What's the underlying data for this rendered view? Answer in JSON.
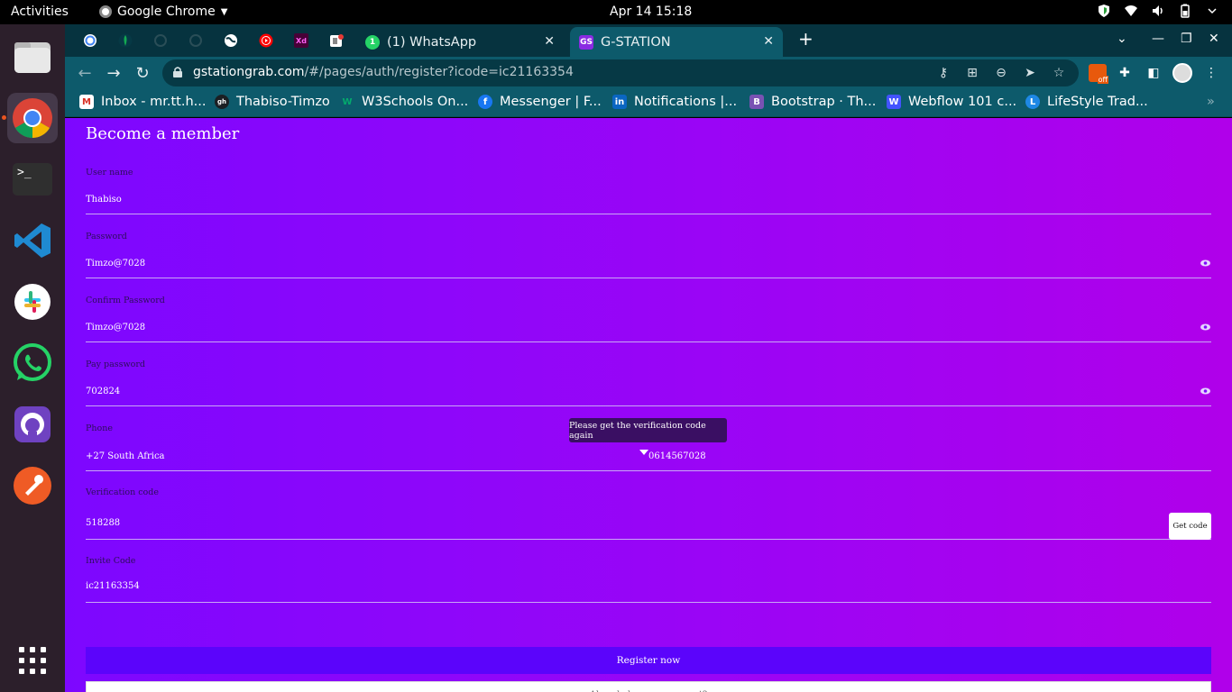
{
  "topbar": {
    "activities": "Activities",
    "app_name": "Google Chrome",
    "clock": "Apr 14  15:18"
  },
  "dock": {
    "items": [
      "files-icon",
      "chrome-icon",
      "terminal-icon",
      "vscode-icon",
      "slack-icon",
      "whatsapp-icon",
      "github-desktop-icon",
      "postman-icon",
      "app-grid-icon"
    ],
    "terminal_glyph": ">_"
  },
  "tabs": [
    {
      "label": "(1) WhatsApp",
      "badge": "1"
    },
    {
      "label": "G-STATION",
      "badge": "GS"
    }
  ],
  "pinned_tab_glyphs": {
    "xd": "Xd"
  },
  "address_bar": {
    "host": "gstationgrab.com",
    "path": "/#/pages/auth/register?icode=ic21163354"
  },
  "bookmarks": [
    {
      "label": "Inbox - mr.tt.h...",
      "icon": "M"
    },
    {
      "label": "Thabiso-Timzo",
      "icon": "gh"
    },
    {
      "label": "W3Schools On...",
      "icon": "W"
    },
    {
      "label": "Messenger | F...",
      "icon": "f"
    },
    {
      "label": "Notifications |...",
      "icon": "in"
    },
    {
      "label": "Bootstrap · Th...",
      "icon": "B"
    },
    {
      "label": "Webflow 101 c...",
      "icon": "W"
    },
    {
      "label": "LifeStyle Trad...",
      "icon": "L"
    }
  ],
  "extension_badge": "off",
  "form": {
    "title": "Become a member",
    "fields": {
      "username": {
        "label": "User name",
        "value": "Thabiso"
      },
      "password": {
        "label": "Password",
        "value": "Timzo@7028"
      },
      "confirm_password": {
        "label": "Confirm Password",
        "value": "Timzo@7028"
      },
      "pay_password": {
        "label": "Pay password",
        "value": "702824"
      },
      "phone": {
        "label": "Phone",
        "country": "+27 South Africa",
        "number": "0614567028"
      },
      "verification": {
        "label": "Verification code",
        "value": "518288",
        "button": "Get code"
      },
      "invite": {
        "label": "Invite Code",
        "value": "ic21163354"
      }
    },
    "toast": "Please get the verification code again",
    "register_button": "Register now",
    "login_link": "Already have an account?"
  },
  "colors": {
    "page_gradient_start": "#7d07ff",
    "page_gradient_end": "#b000ea",
    "register_button": "#5b04fb",
    "chrome_frame": "#0d5a6b"
  }
}
